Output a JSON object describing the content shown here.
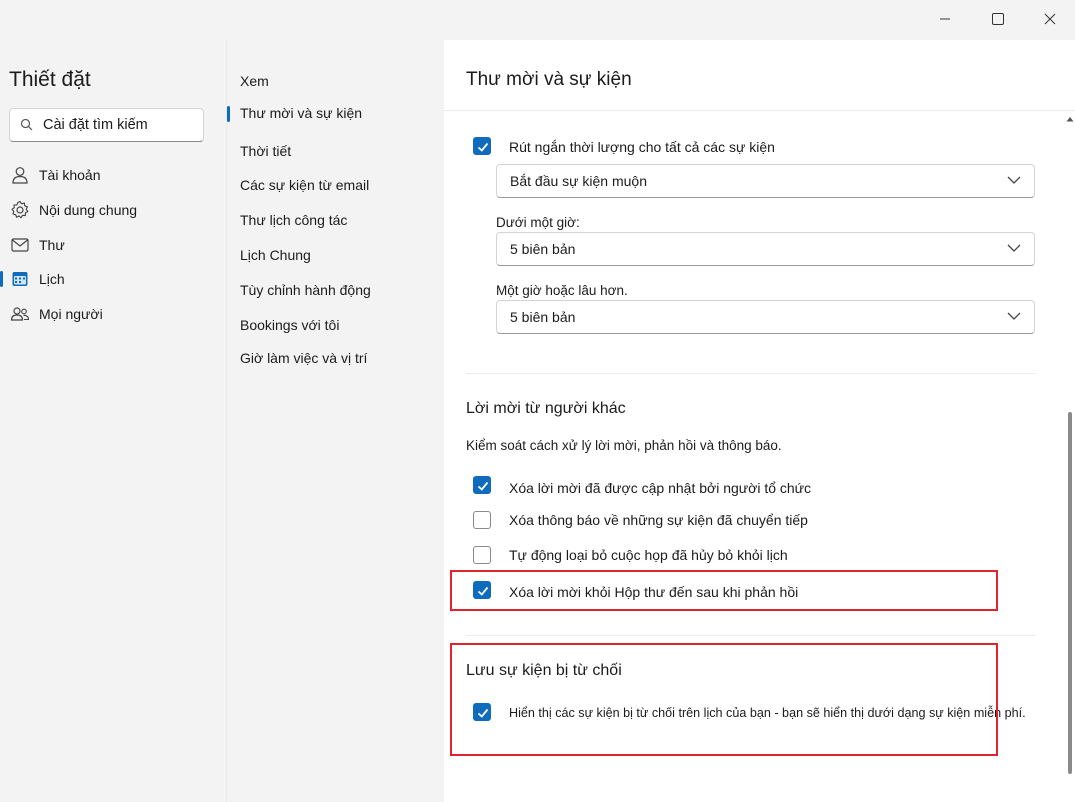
{
  "window": {
    "minimize_icon": "minimize-icon",
    "maximize_icon": "maximize-icon",
    "close_icon": "close-icon"
  },
  "sidebar": {
    "title": "Thiết đặt",
    "search_placeholder": "Cài đặt tìm kiếm",
    "items": [
      {
        "label": "Tài khoản",
        "icon": "person-icon"
      },
      {
        "label": "Nội dung chung",
        "icon": "gear-icon"
      },
      {
        "label": "Thư",
        "icon": "mail-icon"
      },
      {
        "label": "Lịch",
        "icon": "calendar-icon"
      },
      {
        "label": "Mọi người",
        "icon": "people-icon"
      }
    ]
  },
  "subnav": {
    "items": [
      {
        "label": "Xem"
      },
      {
        "label": "Thư mời và sự kiện"
      },
      {
        "label": "Thời tiết"
      },
      {
        "label": "Các sự kiện từ email"
      },
      {
        "label": "Thư lịch công tác"
      },
      {
        "label": "Lịch Chung"
      },
      {
        "label": "Tùy chỉnh hành động"
      },
      {
        "label": "Bookings với tôi"
      },
      {
        "label": "Giờ làm việc và vị trí"
      }
    ]
  },
  "main": {
    "title": "Thư mời và sự kiện",
    "shorten": {
      "checkbox_label": "Rút ngắn thời lượng cho tất cả các sự kiện",
      "checked": true,
      "mode_value": "Bắt đầu sự kiện muộn",
      "under_hour_label": "Dưới một giờ:",
      "under_hour_value": "5 biên bản",
      "over_hour_label": "Một giờ hoặc lâu hơn.",
      "over_hour_value": "5 biên bản"
    },
    "invitations": {
      "title": "Lời mời từ người khác",
      "description": "Kiểm soát cách xử lý lời mời, phản hồi và thông báo.",
      "options": [
        {
          "label": "Xóa lời mời đã được cập nhật bởi người tổ chức",
          "checked": true
        },
        {
          "label": "Xóa thông báo về những sự kiện đã chuyển tiếp",
          "checked": false
        },
        {
          "label": "Tự động loại bỏ cuộc họp đã hủy bỏ khỏi lịch",
          "checked": false
        },
        {
          "label": "Xóa lời mời khỏi Hộp thư đến sau khi phản hồi",
          "checked": true
        }
      ]
    },
    "declined": {
      "title": "Lưu sự kiện bị từ chối",
      "option_label": "Hiển thị các sự kiện bị từ chối trên lịch của bạn - bạn sẽ hiển thị dưới dạng sự kiện miễn phí.",
      "checked": true
    }
  },
  "colors": {
    "accent": "#0f6cbd",
    "highlight": "#e0242d"
  }
}
